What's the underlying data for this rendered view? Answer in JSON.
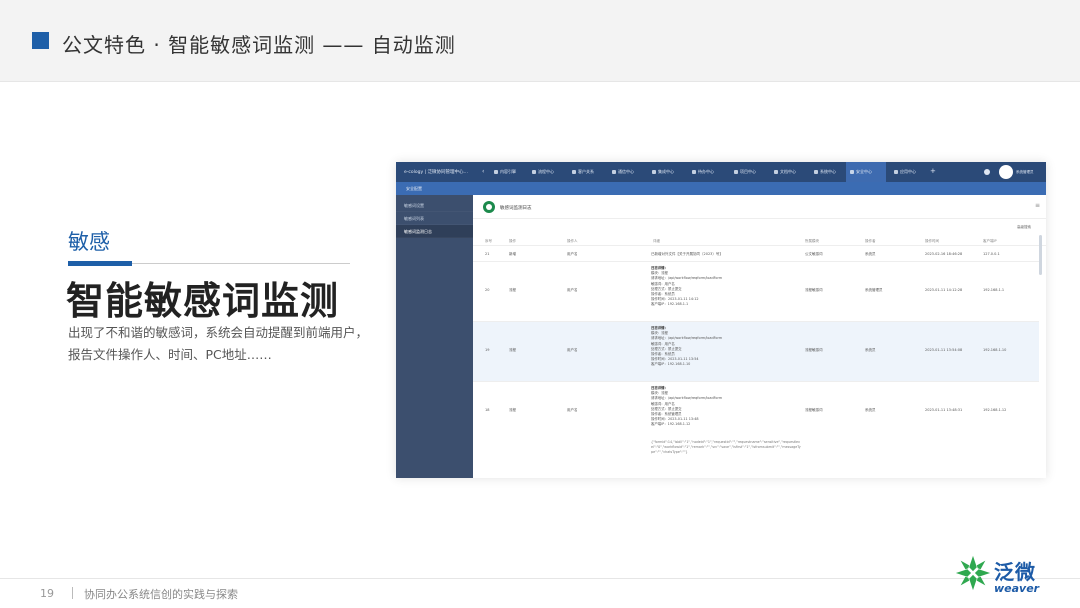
{
  "header": {
    "title": "公文特色 · 智能敏感词监测 —— 自动监测"
  },
  "left": {
    "keyword": "敏感",
    "title": "智能敏感词监测",
    "description": "出现了不和谐的敏感词，系统会自动提醒到前端用户，报告文件操作人、时间、PC地址……"
  },
  "screenshot": {
    "topbar": {
      "brand": "e-cology | 泛微协同管理中心…",
      "nav": [
        "内容引擎",
        "流程中心",
        "客户关系",
        "通信中心",
        "集成中心",
        "待办中心",
        "项目中心",
        "文档中心",
        "系统中心",
        "监控中心",
        "安全中心",
        "应用中心"
      ],
      "user": "系统管理员"
    },
    "subbar": {
      "tab": "安全配置"
    },
    "sidebar": [
      "敏感词设置",
      "敏感词列表",
      "敏感词监测日志"
    ],
    "content": {
      "title": "敏感词监测日志",
      "toolbar_link": "高级搜索",
      "columns": [
        "序号",
        "操作",
        "操作人",
        "详细",
        "所属模块",
        "操作者",
        "操作时间",
        "客户端IP"
      ],
      "rows": [
        {
          "no": "21",
          "op": "新增",
          "user": "用户名",
          "summary": "已新增对外文件【关于开展协同（2023）号】",
          "module": "公文敏感词",
          "operator": "系统员",
          "time": "2023-02-16 18:46:28",
          "ip": "127.0.0.1"
        },
        {
          "no": "20",
          "op": "流程",
          "user": "用户名",
          "detail": [
            "日志详情：",
            "模块：流程",
            "请求地址：/api/workflow/reqform/loadForm",
            "敏感词：用户名",
            "处理方式：禁止提交",
            "操作者：系统员",
            "操作时间：2023-01-11 14:12",
            "客户端IP：192.168.1.1"
          ],
          "module": "流程敏感词",
          "operator": "系统管理员",
          "time": "2023-01-11 14:12:28",
          "ip": "192.168.1.1"
        },
        {
          "no": "19",
          "op": "流程",
          "user": "用户名",
          "detail": [
            "日志详情：",
            "模块：流程",
            "请求地址：/api/workflow/reqform/loadForm",
            "敏感词：用户名",
            "处理方式：禁止提交",
            "操作者：系统员",
            "操作时间：2023-01-11 13:54",
            "客户端IP：192.168.1.10"
          ],
          "module": "流程敏感词",
          "operator": "系统员",
          "time": "2023-01-11 13:54:08",
          "ip": "192.168.1.10"
        },
        {
          "no": "18",
          "op": "流程",
          "user": "用户名",
          "detail": [
            "日志详情：",
            "模块：流程",
            "请求地址：/api/workflow/reqform/loadForm",
            "敏感词：用户名",
            "处理方式：禁止提交",
            "操作者：系统管理员",
            "操作时间：2023-01-11 13:48",
            "客户端IP：192.168.1.12"
          ],
          "module": "流程敏感词",
          "operator": "系统员",
          "time": "2023-01-11 13:48:31",
          "ip": "192.168.1.12"
        }
      ],
      "json_snippet": "{\"formid\":14,\"isbill\":\"1\",\"nodeid\":\"1\",\"requestid\":\"\",\"requestname\":\"sensitive\",\"requestlevel\":\"0\",\"workflowid\":\"1\",\"remark\":\"\",\"src\":\"save\",\"isfirst\":\"1\",\"isfromsubmit\":\"\",\"messageType\":\"\",\"chatsType\":\"\"}"
    }
  },
  "footer": {
    "page": "19",
    "text": "协同办公系统信创的实践与探索"
  },
  "logo": {
    "cn": "泛微",
    "en": "weaver"
  }
}
